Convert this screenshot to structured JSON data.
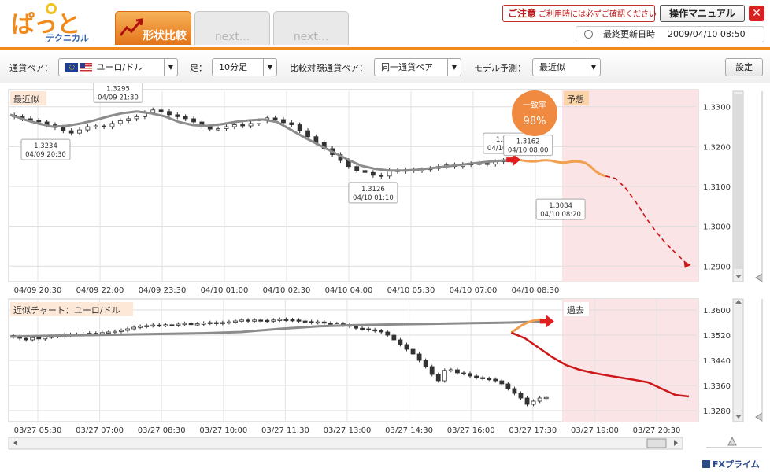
{
  "app": {
    "logo_text": "ぱっと見",
    "logo_sub": "テクニカル",
    "brand": "FXプライム"
  },
  "tabs": [
    {
      "label": "形状比較",
      "active": true
    },
    {
      "label": "next...",
      "active": false
    },
    {
      "label": "next...",
      "active": false
    }
  ],
  "header": {
    "caution_label": "ご注意",
    "caution_note": "ご利用時には必ずご確認ください",
    "manual_label": "操作マニュアル",
    "close_label": "✕",
    "updated_label": "最終更新日時",
    "updated_value": "2009/04/10  08:50"
  },
  "toolbar": {
    "pair_label": "通貨ペア：",
    "pair_value": "ユーロ/ドル",
    "bar_label": "足：",
    "bar_value": "10分足",
    "compare_label": "比較対照通貨ペア：",
    "compare_value": "同一通貨ペア",
    "model_label": "モデル予測：",
    "model_value": "最近似",
    "settings_label": "設定",
    "dropdown_icon": "▼"
  },
  "colors": {
    "accent": "#f08a1c",
    "history_line": "#8c8c8c",
    "match_line": "#f0a050",
    "forecast_line": "#cc1818",
    "forecast_bg": "#fbe4e6",
    "match_arrow": "#e02020",
    "match_badge": "#f08a40"
  },
  "chart_data": [
    {
      "type": "candlestick",
      "name": "top",
      "title": "最近似",
      "forecast_label": "予想",
      "match_badge": {
        "label": "一致率",
        "value": "98%"
      },
      "x_labels": [
        "04/09 20:30",
        "04/09 22:00",
        "04/09 23:30",
        "04/10 01:00",
        "04/10 02:30",
        "04/10 04:00",
        "04/10 05:30",
        "04/10 07:00",
        "04/10 08:30"
      ],
      "y_ticks": [
        1.33,
        1.32,
        1.31,
        1.3,
        1.29
      ],
      "y_tick_labels": [
        "1.3300",
        "1.3200",
        "1.3100",
        "1.3000",
        "1.2900"
      ],
      "ylim": [
        1.2865,
        1.3335
      ],
      "xlim": [
        0,
        84
      ],
      "candle_start": 0,
      "close": [
        1.3275,
        1.327,
        1.3266,
        1.3262,
        1.3255,
        1.3248,
        1.324,
        1.3234,
        1.3242,
        1.325,
        1.3252,
        1.325,
        1.3258,
        1.3265,
        1.327,
        1.3275,
        1.3285,
        1.3292,
        1.3288,
        1.328,
        1.3275,
        1.327,
        1.3262,
        1.325,
        1.3244,
        1.3245,
        1.325,
        1.3255,
        1.3252,
        1.3258,
        1.3265,
        1.3272,
        1.3268,
        1.326,
        1.3255,
        1.324,
        1.3225,
        1.321,
        1.3195,
        1.318,
        1.3165,
        1.315,
        1.314,
        1.3135,
        1.3128,
        1.3126,
        1.314,
        1.3138,
        1.3142,
        1.314,
        1.3142,
        1.3145,
        1.315,
        1.3154,
        1.315,
        1.3155,
        1.3157,
        1.3158,
        1.3156,
        1.3162,
        1.3165,
        1.3167
      ],
      "history_line": [
        1.328,
        1.3268,
        1.3258,
        1.325,
        1.3252,
        1.3258,
        1.3266,
        1.3276,
        1.3284,
        1.3288,
        1.3284,
        1.3276,
        1.3262,
        1.3254,
        1.3252,
        1.3256,
        1.3262,
        1.3266,
        1.3268,
        1.3262,
        1.3242,
        1.3222,
        1.3204,
        1.3186,
        1.3168,
        1.3152,
        1.3144,
        1.314,
        1.314,
        1.3142,
        1.3146,
        1.315,
        1.3154,
        1.3158,
        1.3162,
        1.3165,
        1.3167
      ],
      "match_line": [
        1.3167,
        1.3166,
        1.3164,
        1.3163,
        1.3163,
        1.3165,
        1.3166,
        1.3165,
        1.3162,
        1.316,
        1.316,
        1.3162,
        1.3163,
        1.3162,
        1.3159,
        1.315,
        1.3138,
        1.313,
        1.3126
      ],
      "forecast_line": [
        1.3126,
        1.312,
        1.3095,
        1.306,
        1.302,
        1.2985,
        1.2955,
        1.293,
        1.2905
      ],
      "annotations": [
        {
          "label": "1.3295",
          "time": "04/09 21:30"
        },
        {
          "label": "1.3234",
          "time": "04/09 20:30"
        },
        {
          "label": "1.3126",
          "time": "04/10 01:10"
        },
        {
          "label": "1.3167",
          "time": "04/10 03:50"
        },
        {
          "label": "1.3162",
          "time": "04/10 08:00"
        },
        {
          "label": "1.3084",
          "time": "04/10 08:20"
        }
      ]
    },
    {
      "type": "candlestick",
      "name": "bottom",
      "title": "近似チャート：ユーロ/ドル",
      "forecast_label": "過去",
      "x_labels": [
        "03/27 05:30",
        "03/27 07:00",
        "03/27 08:30",
        "03/27 10:00",
        "03/27 11:30",
        "03/27 13:00",
        "03/27 14:30",
        "03/27 16:00",
        "03/27 17:30",
        "03/27 19:00",
        "03/27 20:30"
      ],
      "y_ticks": [
        1.36,
        1.352,
        1.344,
        1.336,
        1.328
      ],
      "y_tick_labels": [
        "1.3600",
        "1.3520",
        "1.3440",
        "1.3360",
        "1.3280"
      ],
      "ylim": [
        1.325,
        1.363
      ],
      "xlim": [
        0,
        108
      ],
      "candle_start": 0,
      "close": [
        1.3515,
        1.351,
        1.3505,
        1.3512,
        1.3508,
        1.3514,
        1.3516,
        1.3518,
        1.352,
        1.3522,
        1.3522,
        1.3524,
        1.3526,
        1.3526,
        1.3528,
        1.353,
        1.3532,
        1.3535,
        1.354,
        1.3545,
        1.3548,
        1.355,
        1.3552,
        1.3551,
        1.3553,
        1.3552,
        1.3555,
        1.3557,
        1.3554,
        1.3556,
        1.3558,
        1.356,
        1.3557,
        1.356,
        1.3562,
        1.3565,
        1.3568,
        1.3566,
        1.3568,
        1.3567,
        1.3566,
        1.3568,
        1.357,
        1.3569,
        1.3568,
        1.3565,
        1.3563,
        1.356,
        1.3562,
        1.3558,
        1.3555,
        1.3556,
        1.3552,
        1.3548,
        1.3542,
        1.354,
        1.3537,
        1.3534,
        1.353,
        1.352,
        1.3505,
        1.349,
        1.3475,
        1.346,
        1.344,
        1.342,
        1.3395,
        1.3375,
        1.3408,
        1.341,
        1.34,
        1.3398,
        1.339,
        1.3385,
        1.3382,
        1.338,
        1.3375,
        1.3365,
        1.335,
        1.3335,
        1.332,
        1.33,
        1.331,
        1.332,
        1.3322
      ],
      "history_line": [
        1.3515,
        1.3518,
        1.352,
        1.3522,
        1.3524,
        1.3526,
        1.353,
        1.354,
        1.3548,
        1.3552,
        1.3554,
        1.3556,
        1.3558,
        1.356,
        1.3564
      ],
      "match_line": [
        1.3564,
        1.3566,
        1.3568,
        1.3569,
        1.3569,
        1.3568,
        1.3566,
        1.3563,
        1.356,
        1.3556,
        1.3552,
        1.3546,
        1.354,
        1.3534,
        1.3528
      ],
      "forecast_line": [
        1.3528,
        1.351,
        1.348,
        1.345,
        1.3425,
        1.341,
        1.34,
        1.3392,
        1.3385,
        1.3378,
        1.337,
        1.335,
        1.333,
        1.3325
      ]
    }
  ]
}
